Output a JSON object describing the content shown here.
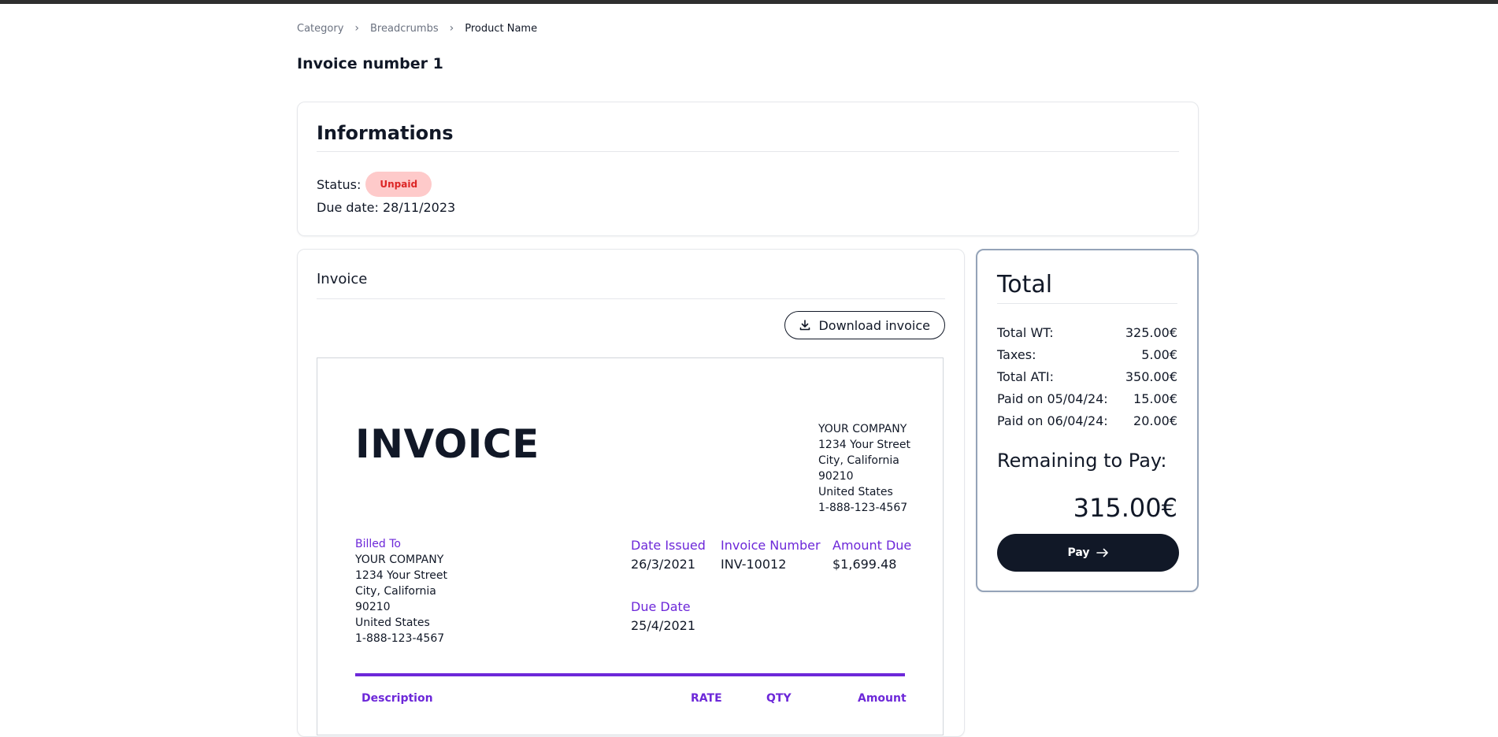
{
  "breadcrumb": {
    "items": [
      "Category",
      "Breadcrumbs"
    ],
    "current": "Product Name"
  },
  "page_title": "Invoice number 1",
  "informations": {
    "title": "Informations",
    "status_label": "Status:",
    "status_value": "Unpaid",
    "due_label": "Due date:",
    "due_value": "28/11/2023"
  },
  "invoice_card": {
    "title": "Invoice",
    "download_label": "Download invoice",
    "doc": {
      "title": "INVOICE",
      "company": [
        "YOUR COMPANY",
        "1234 Your Street",
        "City, California",
        "90210",
        "United States",
        "1-888-123-4567"
      ],
      "billed_to_label": "Billed To",
      "billed_to": [
        "YOUR COMPANY",
        "1234 Your Street",
        "City, California",
        "90210",
        "United States",
        "1-888-123-4567"
      ],
      "date_issued_label": "Date Issued",
      "date_issued": "26/3/2021",
      "invoice_number_label": "Invoice Number",
      "invoice_number": "INV-10012",
      "amount_due_label": "Amount Due",
      "amount_due": "$1,699.48",
      "due_date_label": "Due Date",
      "due_date": "25/4/2021",
      "table_headers": [
        "Description",
        "RATE",
        "QTY",
        "Amount"
      ]
    }
  },
  "total": {
    "title": "Total",
    "rows": [
      {
        "label": "Total WT:",
        "value": "325.00€"
      },
      {
        "label": "Taxes:",
        "value": "5.00€"
      },
      {
        "label": "Total ATI:",
        "value": "350.00€"
      },
      {
        "label": "Paid on 05/04/24:",
        "value": "15.00€"
      },
      {
        "label": "Paid on 06/04/24:",
        "value": "20.00€"
      }
    ],
    "remaining_label": "Remaining to Pay:",
    "remaining_value": "315.00€",
    "pay_label": "Pay",
    "pay_icon": "arrow-right-icon"
  },
  "colors": {
    "accent": "#6d28d9",
    "badge_bg": "#fecaca",
    "badge_text": "#dc2626",
    "button_dark": "#111827"
  }
}
